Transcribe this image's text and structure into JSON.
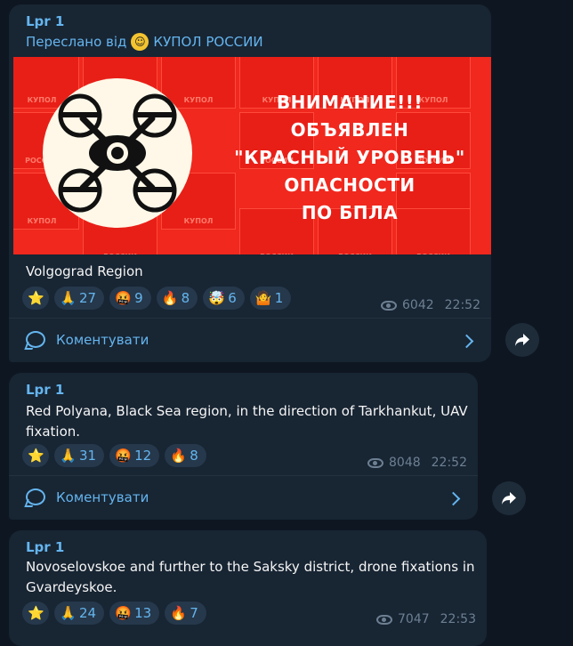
{
  "messages": [
    {
      "sender": "Lpr 1",
      "forwarded_prefix": "Переслано від",
      "forwarded_source": "КУПОЛ РОССИИ",
      "banner": {
        "tile_label_1": "КУПОЛ",
        "tile_label_2": "РОССИИ",
        "lines": [
          "ВНИМАНИЕ!!!",
          "ОБЪЯВЛЕН",
          "\"КРАСНЫЙ УРОВЕНЬ\"",
          "ОПАСНОСТИ",
          "ПО БПЛА"
        ]
      },
      "text": "Volgograd Region",
      "reactions": [
        {
          "icon": "star-icon",
          "glyph": "⭐",
          "count": ""
        },
        {
          "icon": "pray-icon",
          "glyph": "🙏",
          "count": "27"
        },
        {
          "icon": "angry-face-icon",
          "glyph": "🤬",
          "count": "9"
        },
        {
          "icon": "fire-icon",
          "glyph": "🔥",
          "count": "8"
        },
        {
          "icon": "exploding-head-icon",
          "glyph": "🤯",
          "count": "6"
        },
        {
          "icon": "shrug-icon",
          "glyph": "🤷",
          "count": "1"
        }
      ],
      "views": "6042",
      "time": "22:52",
      "comment_label": "Коментувати"
    },
    {
      "sender": "Lpr 1",
      "text": "Red Polyana, Black Sea region, in the direction of Tarkhankut, UAV fixation.",
      "reactions": [
        {
          "icon": "star-icon",
          "glyph": "⭐",
          "count": ""
        },
        {
          "icon": "pray-icon",
          "glyph": "🙏",
          "count": "31"
        },
        {
          "icon": "angry-face-icon",
          "glyph": "🤬",
          "count": "12"
        },
        {
          "icon": "fire-icon",
          "glyph": "🔥",
          "count": "8"
        }
      ],
      "views": "8048",
      "time": "22:52",
      "comment_label": "Коментувати"
    },
    {
      "sender": "Lpr 1",
      "text": "Novoselovskoe and further to the Saksky district, drone fixations in Gvardeyskoe.",
      "reactions": [
        {
          "icon": "star-icon",
          "glyph": "⭐",
          "count": ""
        },
        {
          "icon": "pray-icon",
          "glyph": "🙏",
          "count": "24"
        },
        {
          "icon": "angry-face-icon",
          "glyph": "🤬",
          "count": "13"
        },
        {
          "icon": "fire-icon",
          "glyph": "🔥",
          "count": "7"
        }
      ],
      "views": "7047",
      "time": "22:53"
    }
  ],
  "colors": {
    "background": "#0e1621",
    "bubble": "#182533",
    "accent": "#64b5ef",
    "banner_red": "#f0281e"
  }
}
